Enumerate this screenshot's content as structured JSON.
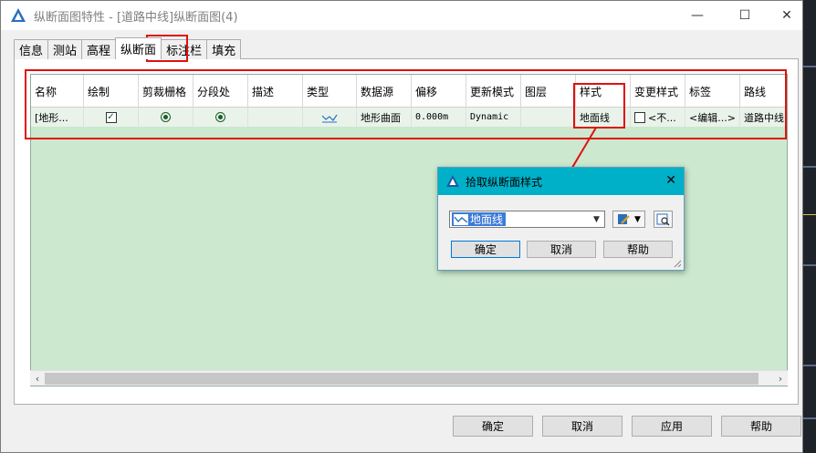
{
  "window": {
    "title": "纵断面图特性 - [道路中线]纵断面图(4)",
    "minimize": "—",
    "maximize": "☐",
    "close": "✕"
  },
  "tabs": [
    {
      "label": "信息"
    },
    {
      "label": "测站"
    },
    {
      "label": "高程"
    },
    {
      "label": "纵断面",
      "active": true
    },
    {
      "label": "标注栏"
    },
    {
      "label": "填充"
    }
  ],
  "grid": {
    "columns": [
      "名称",
      "绘制",
      "剪裁栅格",
      "分段处",
      "描述",
      "类型",
      "数据源",
      "偏移",
      "更新模式",
      "图层",
      "样式",
      "变更样式",
      "标签",
      "路线"
    ],
    "row": {
      "name": "[地形...",
      "draw": true,
      "clip_grid": true,
      "split_at": true,
      "description": "",
      "type_icon": "profile-line-icon",
      "source": "地形曲面",
      "offset": "0.000m",
      "update_mode": "Dynamic",
      "layer": "",
      "style": "地面线",
      "override_style": "<不...",
      "labels": "<编辑...>",
      "alignment": "道路中线"
    },
    "colors": {
      "background": "#cce8cf",
      "row": "#e9f3ea",
      "check": "#1a5d2a"
    }
  },
  "buttons": {
    "ok": "确定",
    "cancel": "取消",
    "apply": "应用",
    "help": "帮助"
  },
  "dialog": {
    "title": "拾取纵断面样式",
    "selected_style": "地面线",
    "ok": "确定",
    "cancel": "取消",
    "help": "帮助",
    "close": "✕",
    "title_color": "#00b0c8"
  },
  "annotations": {
    "highlight_color": "#e01010"
  }
}
